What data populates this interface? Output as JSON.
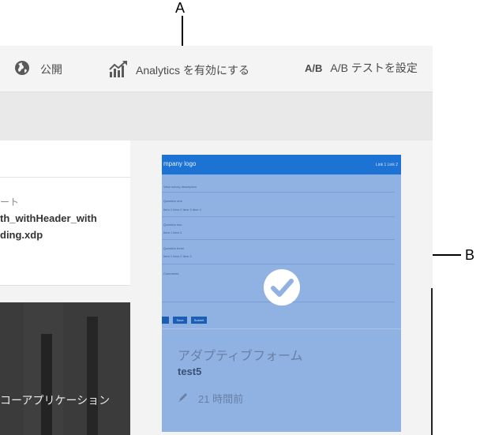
{
  "toolbar": {
    "publish_label": "公開",
    "analytics_label": "Analytics を有効にする",
    "ab_icon_text": "A/B",
    "ab_label": "A/B テストを設定"
  },
  "left_cards": {
    "card_type_fragment": "ート",
    "card_name_line1": "th_withHeader_with",
    "card_name_line2": "ding.xdp",
    "dark_card_title": "コーアプリケーション"
  },
  "thumbnail": {
    "logo_text": "mpany logo",
    "header_right_text": "Link 1   Link 2",
    "survey_desc": "View survey description",
    "q1": "Question one",
    "q1_opts": "Item 1   Item 2   Item 3   Item 4",
    "q2": "Question two",
    "q2_opts": "Item 1   Item 2",
    "q3": "Question three",
    "q3_opts": "Item 1     Item 2     Item 3",
    "comments": "Comments",
    "btn1": "Save",
    "btn2": "Submit",
    "type": "アダプティブフォーム",
    "name": "test5",
    "time": "21 時間前",
    "selected": true
  },
  "callouts": {
    "a": "A",
    "b": "B"
  },
  "colors": {
    "thumb_overlay": "#8fb2e3",
    "thumb_header": "#1d73d3",
    "toolbar_bg": "#f4f4f4"
  },
  "icons": {
    "publish": "globe-icon",
    "analytics": "bar-chart-icon",
    "check": "checkmark-icon",
    "edit": "pencil-icon"
  }
}
